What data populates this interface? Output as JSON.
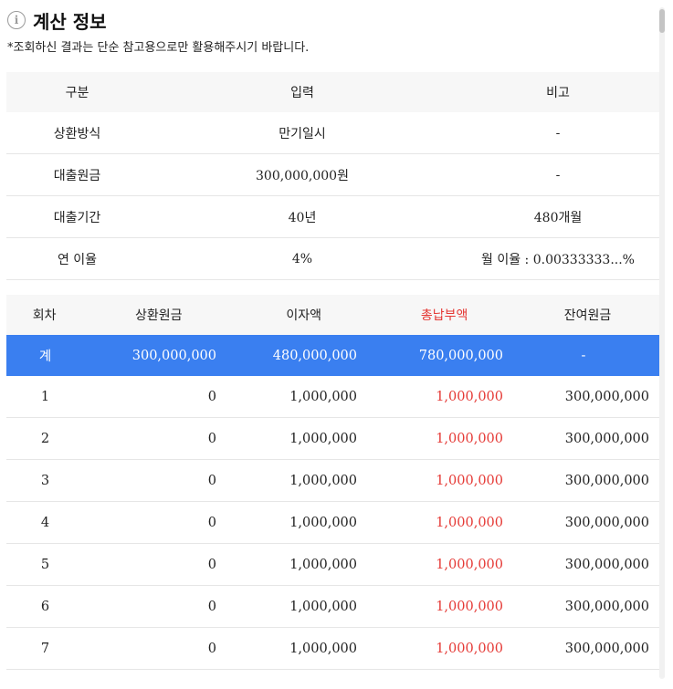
{
  "header": {
    "title": "계산 정보",
    "icon": "info-icon"
  },
  "notice": "*조회하신 결과는 단순 참고용으로만 활용해주시기 바랍니다.",
  "info_table": {
    "headers": [
      "구분",
      "입력",
      "비고"
    ],
    "rows": [
      [
        "상환방식",
        "만기일시",
        "-"
      ],
      [
        "대출원금",
        "300,000,000원",
        "-"
      ],
      [
        "대출기간",
        "40년",
        "480개월"
      ],
      [
        "연 이율",
        "4%",
        "월 이율 : 0.00333333...%"
      ]
    ]
  },
  "schedule_table": {
    "headers": [
      "회차",
      "상환원금",
      "이자액",
      "총납부액",
      "잔여원금"
    ],
    "total": [
      "계",
      "300,000,000",
      "480,000,000",
      "780,000,000",
      "-"
    ],
    "rows": [
      [
        "1",
        "0",
        "1,000,000",
        "1,000,000",
        "300,000,000"
      ],
      [
        "2",
        "0",
        "1,000,000",
        "1,000,000",
        "300,000,000"
      ],
      [
        "3",
        "0",
        "1,000,000",
        "1,000,000",
        "300,000,000"
      ],
      [
        "4",
        "0",
        "1,000,000",
        "1,000,000",
        "300,000,000"
      ],
      [
        "5",
        "0",
        "1,000,000",
        "1,000,000",
        "300,000,000"
      ],
      [
        "6",
        "0",
        "1,000,000",
        "1,000,000",
        "300,000,000"
      ],
      [
        "7",
        "0",
        "1,000,000",
        "1,000,000",
        "300,000,000"
      ]
    ]
  },
  "colors": {
    "accent": "#3a7ff0",
    "highlight": "#e53935",
    "header_bg": "#f7f7f7"
  }
}
